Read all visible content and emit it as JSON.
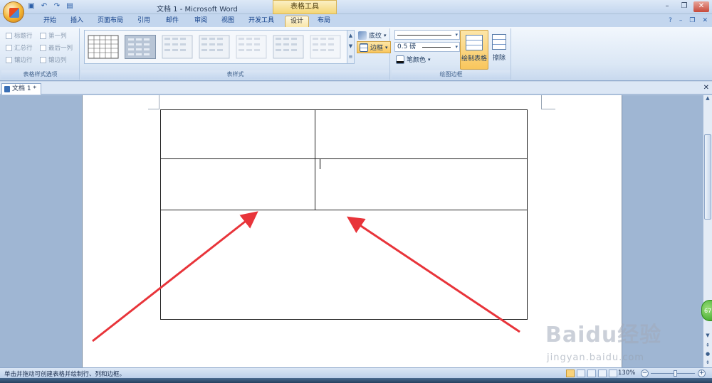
{
  "window": {
    "title": "文档 1 - Microsoft Word",
    "context_tab_group": "表格工具"
  },
  "tabs": [
    {
      "label": "开始"
    },
    {
      "label": "插入"
    },
    {
      "label": "页面布局"
    },
    {
      "label": "引用"
    },
    {
      "label": "邮件"
    },
    {
      "label": "审阅"
    },
    {
      "label": "视图"
    },
    {
      "label": "开发工具"
    },
    {
      "label": "设计",
      "active": true
    },
    {
      "label": "布局"
    }
  ],
  "ribbon": {
    "style_options": {
      "label": "表格样式选项",
      "checkboxes": [
        "标题行",
        "第一列",
        "汇总行",
        "最后一列",
        "镶边行",
        "镶边列"
      ]
    },
    "table_styles": {
      "label": "表样式",
      "shading": "底纹",
      "borders": "边框"
    },
    "draw_borders": {
      "label": "绘图边框",
      "weight": "0.5 磅",
      "pen_color": "笔颜色",
      "draw_table": "绘制表格",
      "eraser": "擦除"
    }
  },
  "document": {
    "tab_label": "文档 1 *"
  },
  "status": {
    "hint": "单击并拖动可创建表格并绘制行、列和边框。",
    "zoom": "130%",
    "badge": "67"
  },
  "watermark": {
    "main": "Baidu经验",
    "sub": "jingyan.baidu.com"
  },
  "colors": {
    "arrow": "#e8343a",
    "accent": "#f8c65c"
  }
}
